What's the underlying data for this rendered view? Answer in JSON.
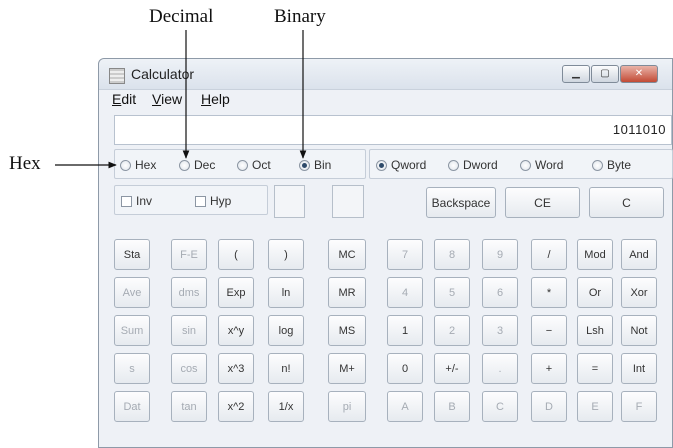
{
  "callouts": {
    "decimal": "Decimal",
    "binary": "Binary",
    "hex": "Hex"
  },
  "window": {
    "title": "Calculator",
    "minimize": "▁",
    "maximize": "▢",
    "close": "✕"
  },
  "menu": [
    {
      "acc": "E",
      "rest": "dit"
    },
    {
      "acc": "V",
      "rest": "iew"
    },
    {
      "acc": "H",
      "rest": "elp"
    }
  ],
  "display": {
    "value": "1011010"
  },
  "base_radios": [
    {
      "label": "Hex",
      "selected": false
    },
    {
      "label": "Dec",
      "selected": false
    },
    {
      "label": "Oct",
      "selected": false
    },
    {
      "label": "Bin",
      "selected": true
    }
  ],
  "word_radios": [
    {
      "label": "Qword",
      "selected": true
    },
    {
      "label": "Dword",
      "selected": false
    },
    {
      "label": "Word",
      "selected": false
    },
    {
      "label": "Byte",
      "selected": false
    }
  ],
  "checks": [
    {
      "label": "Inv",
      "checked": false
    },
    {
      "label": "Hyp",
      "checked": false
    }
  ],
  "top_buttons": [
    "Backspace",
    "CE",
    "C"
  ],
  "keypad": [
    [
      "Sta",
      "F-E",
      "(",
      ")",
      "MC",
      "7",
      "8",
      "9",
      "/",
      "Mod",
      "And"
    ],
    [
      "Ave",
      "dms",
      "Exp",
      "ln",
      "MR",
      "4",
      "5",
      "6",
      "*",
      "Or",
      "Xor"
    ],
    [
      "Sum",
      "sin",
      "x^y",
      "log",
      "MS",
      "1",
      "2",
      "3",
      "−",
      "Lsh",
      "Not"
    ],
    [
      "s",
      "cos",
      "x^3",
      "n!",
      "M+",
      "0",
      "+/-",
      ".",
      "+",
      "=",
      "Int"
    ],
    [
      "Dat",
      "tan",
      "x^2",
      "1/x",
      "pi",
      "A",
      "B",
      "C",
      "D",
      "E",
      "F"
    ]
  ],
  "keypad_enabled": [
    [
      true,
      false,
      true,
      true,
      true,
      false,
      false,
      false,
      true,
      true,
      true
    ],
    [
      false,
      false,
      true,
      true,
      true,
      false,
      false,
      false,
      true,
      true,
      true
    ],
    [
      false,
      false,
      true,
      true,
      true,
      true,
      false,
      false,
      true,
      true,
      true
    ],
    [
      false,
      false,
      true,
      true,
      true,
      true,
      true,
      false,
      true,
      true,
      true
    ],
    [
      false,
      false,
      true,
      true,
      false,
      false,
      false,
      false,
      false,
      false,
      false
    ]
  ]
}
